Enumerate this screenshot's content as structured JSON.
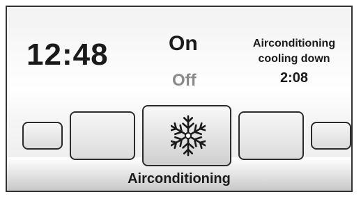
{
  "display": {
    "time": "12:48",
    "state_on": "On",
    "state_off": "Off",
    "status_line1": "Airconditioning",
    "status_line2": "cooling down",
    "countdown": "2:08",
    "mode_label": "Airconditioning"
  },
  "icons": {
    "center_button": "snowflake-icon"
  },
  "colors": {
    "text": "#1a1a1a",
    "inactive_text": "#8a8a8a",
    "border": "#2b2b2b"
  }
}
